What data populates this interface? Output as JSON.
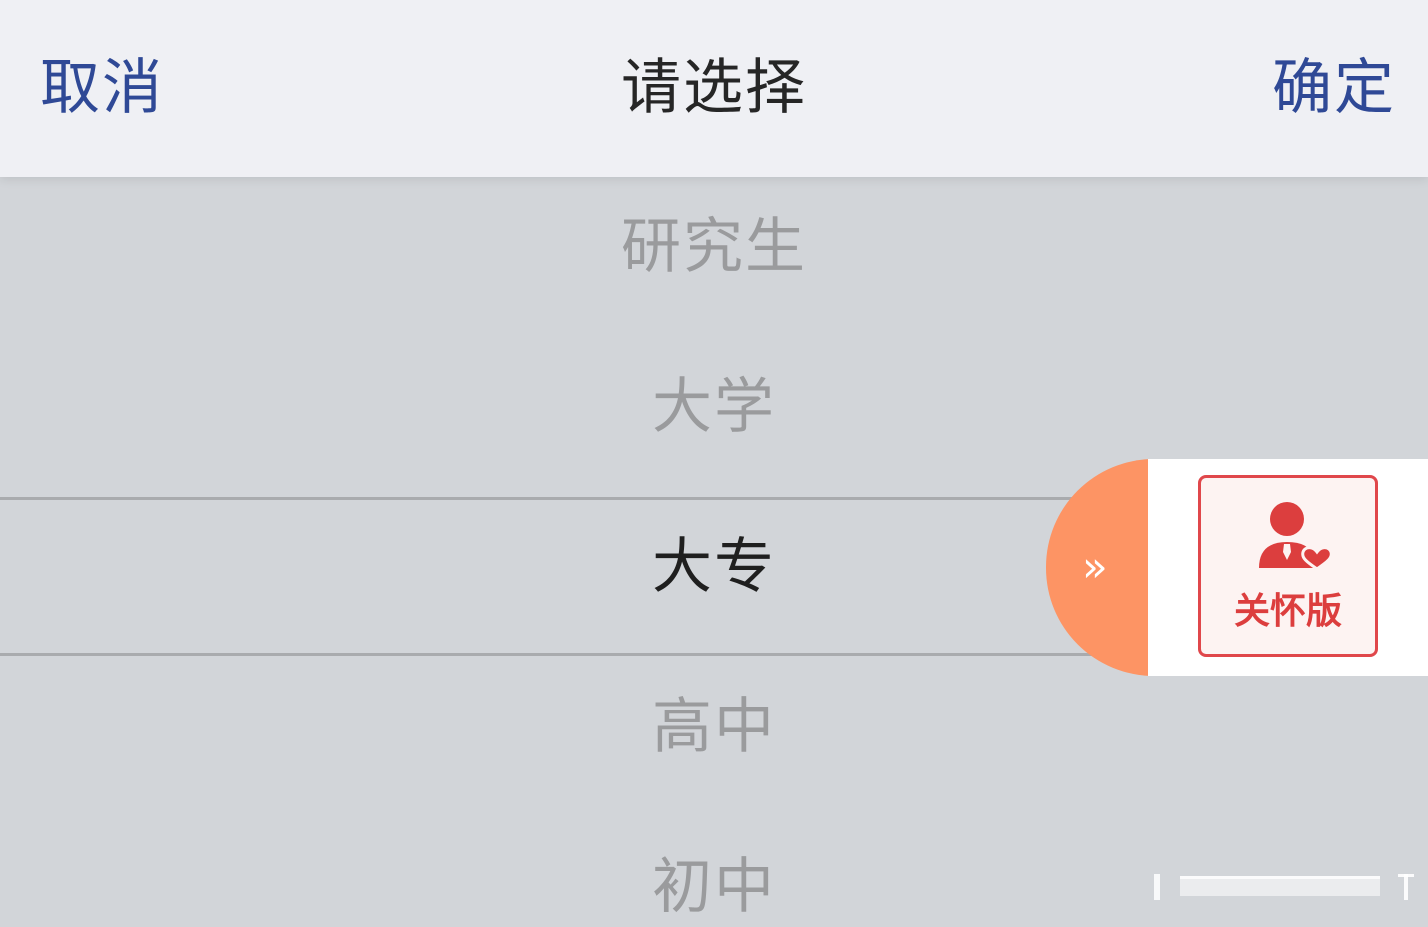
{
  "header": {
    "cancel_label": "取消",
    "title": "请选择",
    "confirm_label": "确定"
  },
  "picker": {
    "options": [
      "研究生",
      "大学",
      "大专",
      "高中",
      "初中"
    ],
    "selected_index": 2
  },
  "care_mode": {
    "label": "关怀版",
    "expand_icon": "double-chevron-right-icon",
    "person_icon": "person-heart-icon"
  },
  "colors": {
    "accent_blue": "#2f4996",
    "care_orange": "#fd9464",
    "care_red": "#dc3e3e"
  }
}
